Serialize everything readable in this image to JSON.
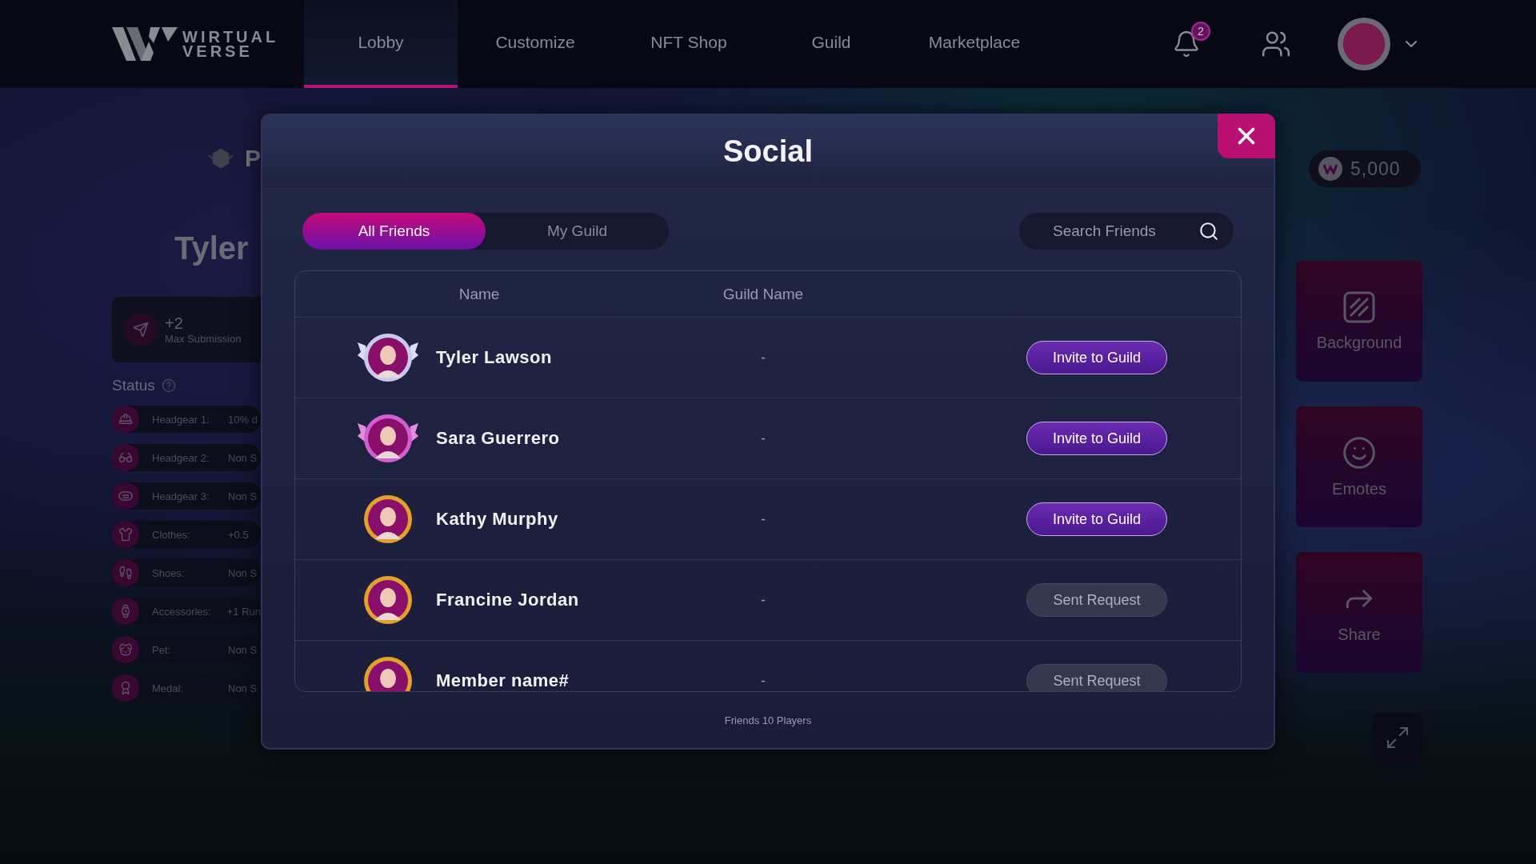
{
  "nav": {
    "logo": {
      "line1": "WIRTUAL",
      "line2": "VERSE"
    },
    "tabs": [
      {
        "label": "Lobby",
        "selected": true
      },
      {
        "label": "Customize",
        "selected": false
      },
      {
        "label": "NFT Shop",
        "selected": false
      },
      {
        "label": "Guild",
        "selected": false
      },
      {
        "label": "Marketplace",
        "selected": false
      }
    ],
    "notifications": "2"
  },
  "profile": {
    "title": "P",
    "name": "Tyler",
    "submission": {
      "value": "+2",
      "label": "Max Submission"
    },
    "status_label": "Status",
    "status": [
      {
        "kind": "cap",
        "label": "Headgear 1:",
        "value": "10% d"
      },
      {
        "kind": "glasses",
        "label": "Headgear 2:",
        "value": "Non S"
      },
      {
        "kind": "mask",
        "label": "Headgear 3:",
        "value": "Non S"
      },
      {
        "kind": "shirt",
        "label": "Clothes:",
        "value": "+0.5"
      },
      {
        "kind": "shoe",
        "label": "Shoes:",
        "value": "Non S"
      },
      {
        "kind": "watch",
        "label": "Accessories:",
        "value": "+1 Run"
      },
      {
        "kind": "pet",
        "label": "Pet:",
        "value": "Non S"
      },
      {
        "kind": "medal",
        "label": "Medal:",
        "value": "Non S"
      }
    ]
  },
  "wallet": {
    "balance": "5,000"
  },
  "side_actions": [
    {
      "kind": "background",
      "label": "Background"
    },
    {
      "kind": "emotes",
      "label": "Emotes"
    },
    {
      "kind": "share",
      "label": "Share"
    }
  ],
  "social": {
    "title": "Social",
    "tabs": [
      {
        "label": "All Friends",
        "selected": true
      },
      {
        "label": "My Guild",
        "selected": false
      }
    ],
    "search": {
      "placeholder": "Search Friends"
    },
    "columns": [
      "Name",
      "Guild Name"
    ],
    "rows": [
      {
        "kind": "silver-wings",
        "name": "Tyler Lawson",
        "guild": "-",
        "action": {
          "kind": "invite",
          "label": "Invite to Guild"
        }
      },
      {
        "kind": "pink-wings",
        "name": "Sara Guerrero",
        "guild": "-",
        "action": {
          "kind": "invite",
          "label": "Invite to Guild"
        }
      },
      {
        "kind": "gold-ring",
        "name": "Kathy Murphy",
        "guild": "-",
        "action": {
          "kind": "invite",
          "label": "Invite to Guild"
        }
      },
      {
        "kind": "gold-ring",
        "name": "Francine Jordan",
        "guild": "-",
        "action": {
          "kind": "sent",
          "label": "Sent Request"
        }
      },
      {
        "kind": "gold-ring",
        "name": "Member name#",
        "guild": "-",
        "action": {
          "kind": "sent",
          "label": "Sent Request"
        }
      }
    ],
    "footer": "Friends 10 Players"
  }
}
